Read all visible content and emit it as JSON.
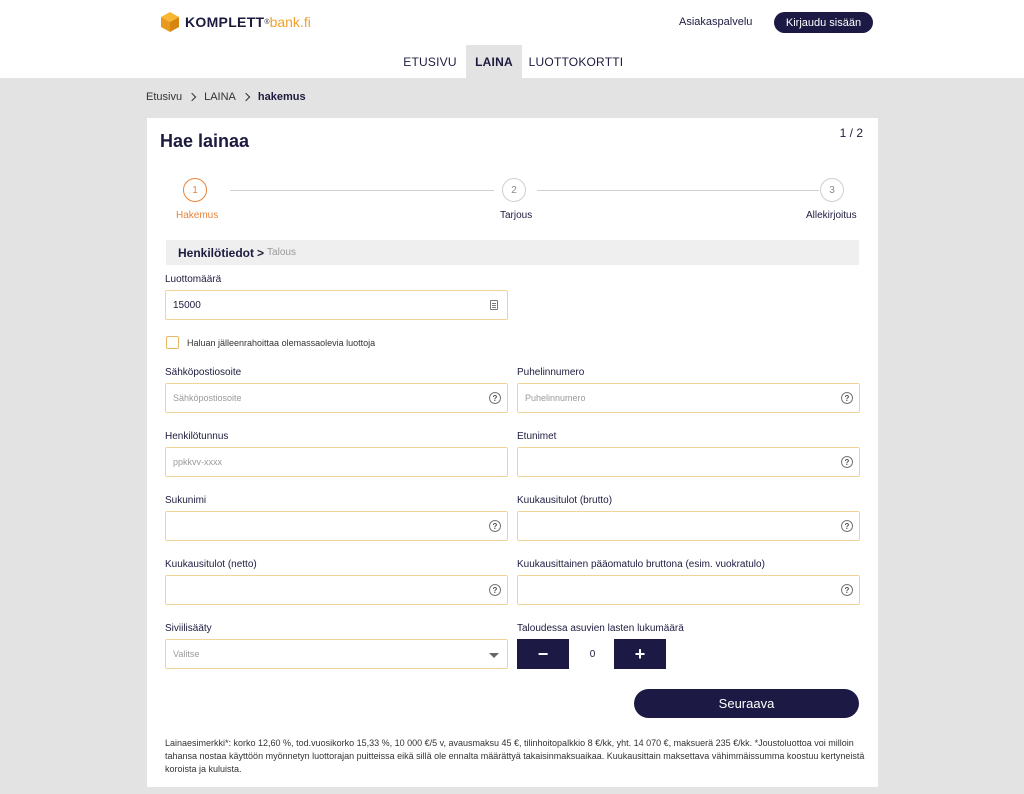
{
  "header": {
    "logo_text": "KOMPLETT",
    "logo_sup": "®",
    "logo_domain": "bank.fi",
    "help_link": "Asiakaspalvelu",
    "login_button": "Kirjaudu sisään"
  },
  "nav": {
    "tabs": [
      {
        "label": "ETUSIVU"
      },
      {
        "label": "LAINA"
      },
      {
        "label": "LUOTTOKORTTI"
      }
    ],
    "active_tab": "LAINA"
  },
  "breadcrumb": {
    "items": [
      "Etusivu",
      "LAINA",
      "hakemus"
    ]
  },
  "form": {
    "title": "Hae lainaa",
    "page_count": "1 / 2",
    "steps": [
      {
        "number": "1",
        "label": "Hakemus"
      },
      {
        "number": "2",
        "label": "Tarjous"
      },
      {
        "number": "3",
        "label": "Allekirjoitus"
      }
    ],
    "active_step": 1,
    "section": {
      "main": "Henkilötiedot",
      "separator": ">",
      "sub": "Talous"
    },
    "loan_amount": {
      "label": "Luottomäärä",
      "value": "15000"
    },
    "refinance_checkbox": {
      "label": "Haluan jälleenrahoittaa olemassaolevia luottoja",
      "checked": false
    },
    "email": {
      "label": "Sähköpostiosoite",
      "placeholder": "Sähköpostiosoite"
    },
    "phone": {
      "label": "Puhelinnumero",
      "placeholder": "Puhelinnumero"
    },
    "ssn": {
      "label": "Henkilötunnus",
      "placeholder": "ppkkvv-xxxx"
    },
    "first_names": {
      "label": "Etunimet",
      "placeholder": ""
    },
    "last_name": {
      "label": "Sukunimi",
      "placeholder": ""
    },
    "income_gross": {
      "label": "Kuukausitulot (brutto)",
      "placeholder": ""
    },
    "income_net": {
      "label": "Kuukausitulot (netto)",
      "placeholder": ""
    },
    "capital_income": {
      "label": "Kuukausittainen pääomatulo bruttona (esim. vuokratulo)",
      "placeholder": ""
    },
    "marital_status": {
      "label": "Siviilisääty",
      "selected": "Valitse"
    },
    "children": {
      "label": "Taloudessa asuvien lasten lukumäärä",
      "value": "0",
      "minus": "−",
      "plus": "+"
    },
    "next_button": "Seuraava"
  },
  "disclaimer": "Lainaesimerkki*: korko 12,60 %, tod.vuosikorko 15,33 %, 10 000 €/5 v, avausmaksu 45 €, tilinhoitopalkkio 8 €/kk, yht. 14 070 €, maksuerä 235 €/kk. *Joustoluottoa voi milloin tahansa nostaa käyttöön myönnetyn luottorajan puitteissa eikä sillä ole ennalta määrättyä takaisinmaksuaikaa. Kuukausittain maksettava vähimmäissumma koostuu kertyneistä koroista ja kuluista.",
  "colors": {
    "brand_navy": "#1c1a44",
    "accent_orange": "#e8843a",
    "logo_gold": "#f2a12c",
    "field_border": "#f0d399"
  }
}
